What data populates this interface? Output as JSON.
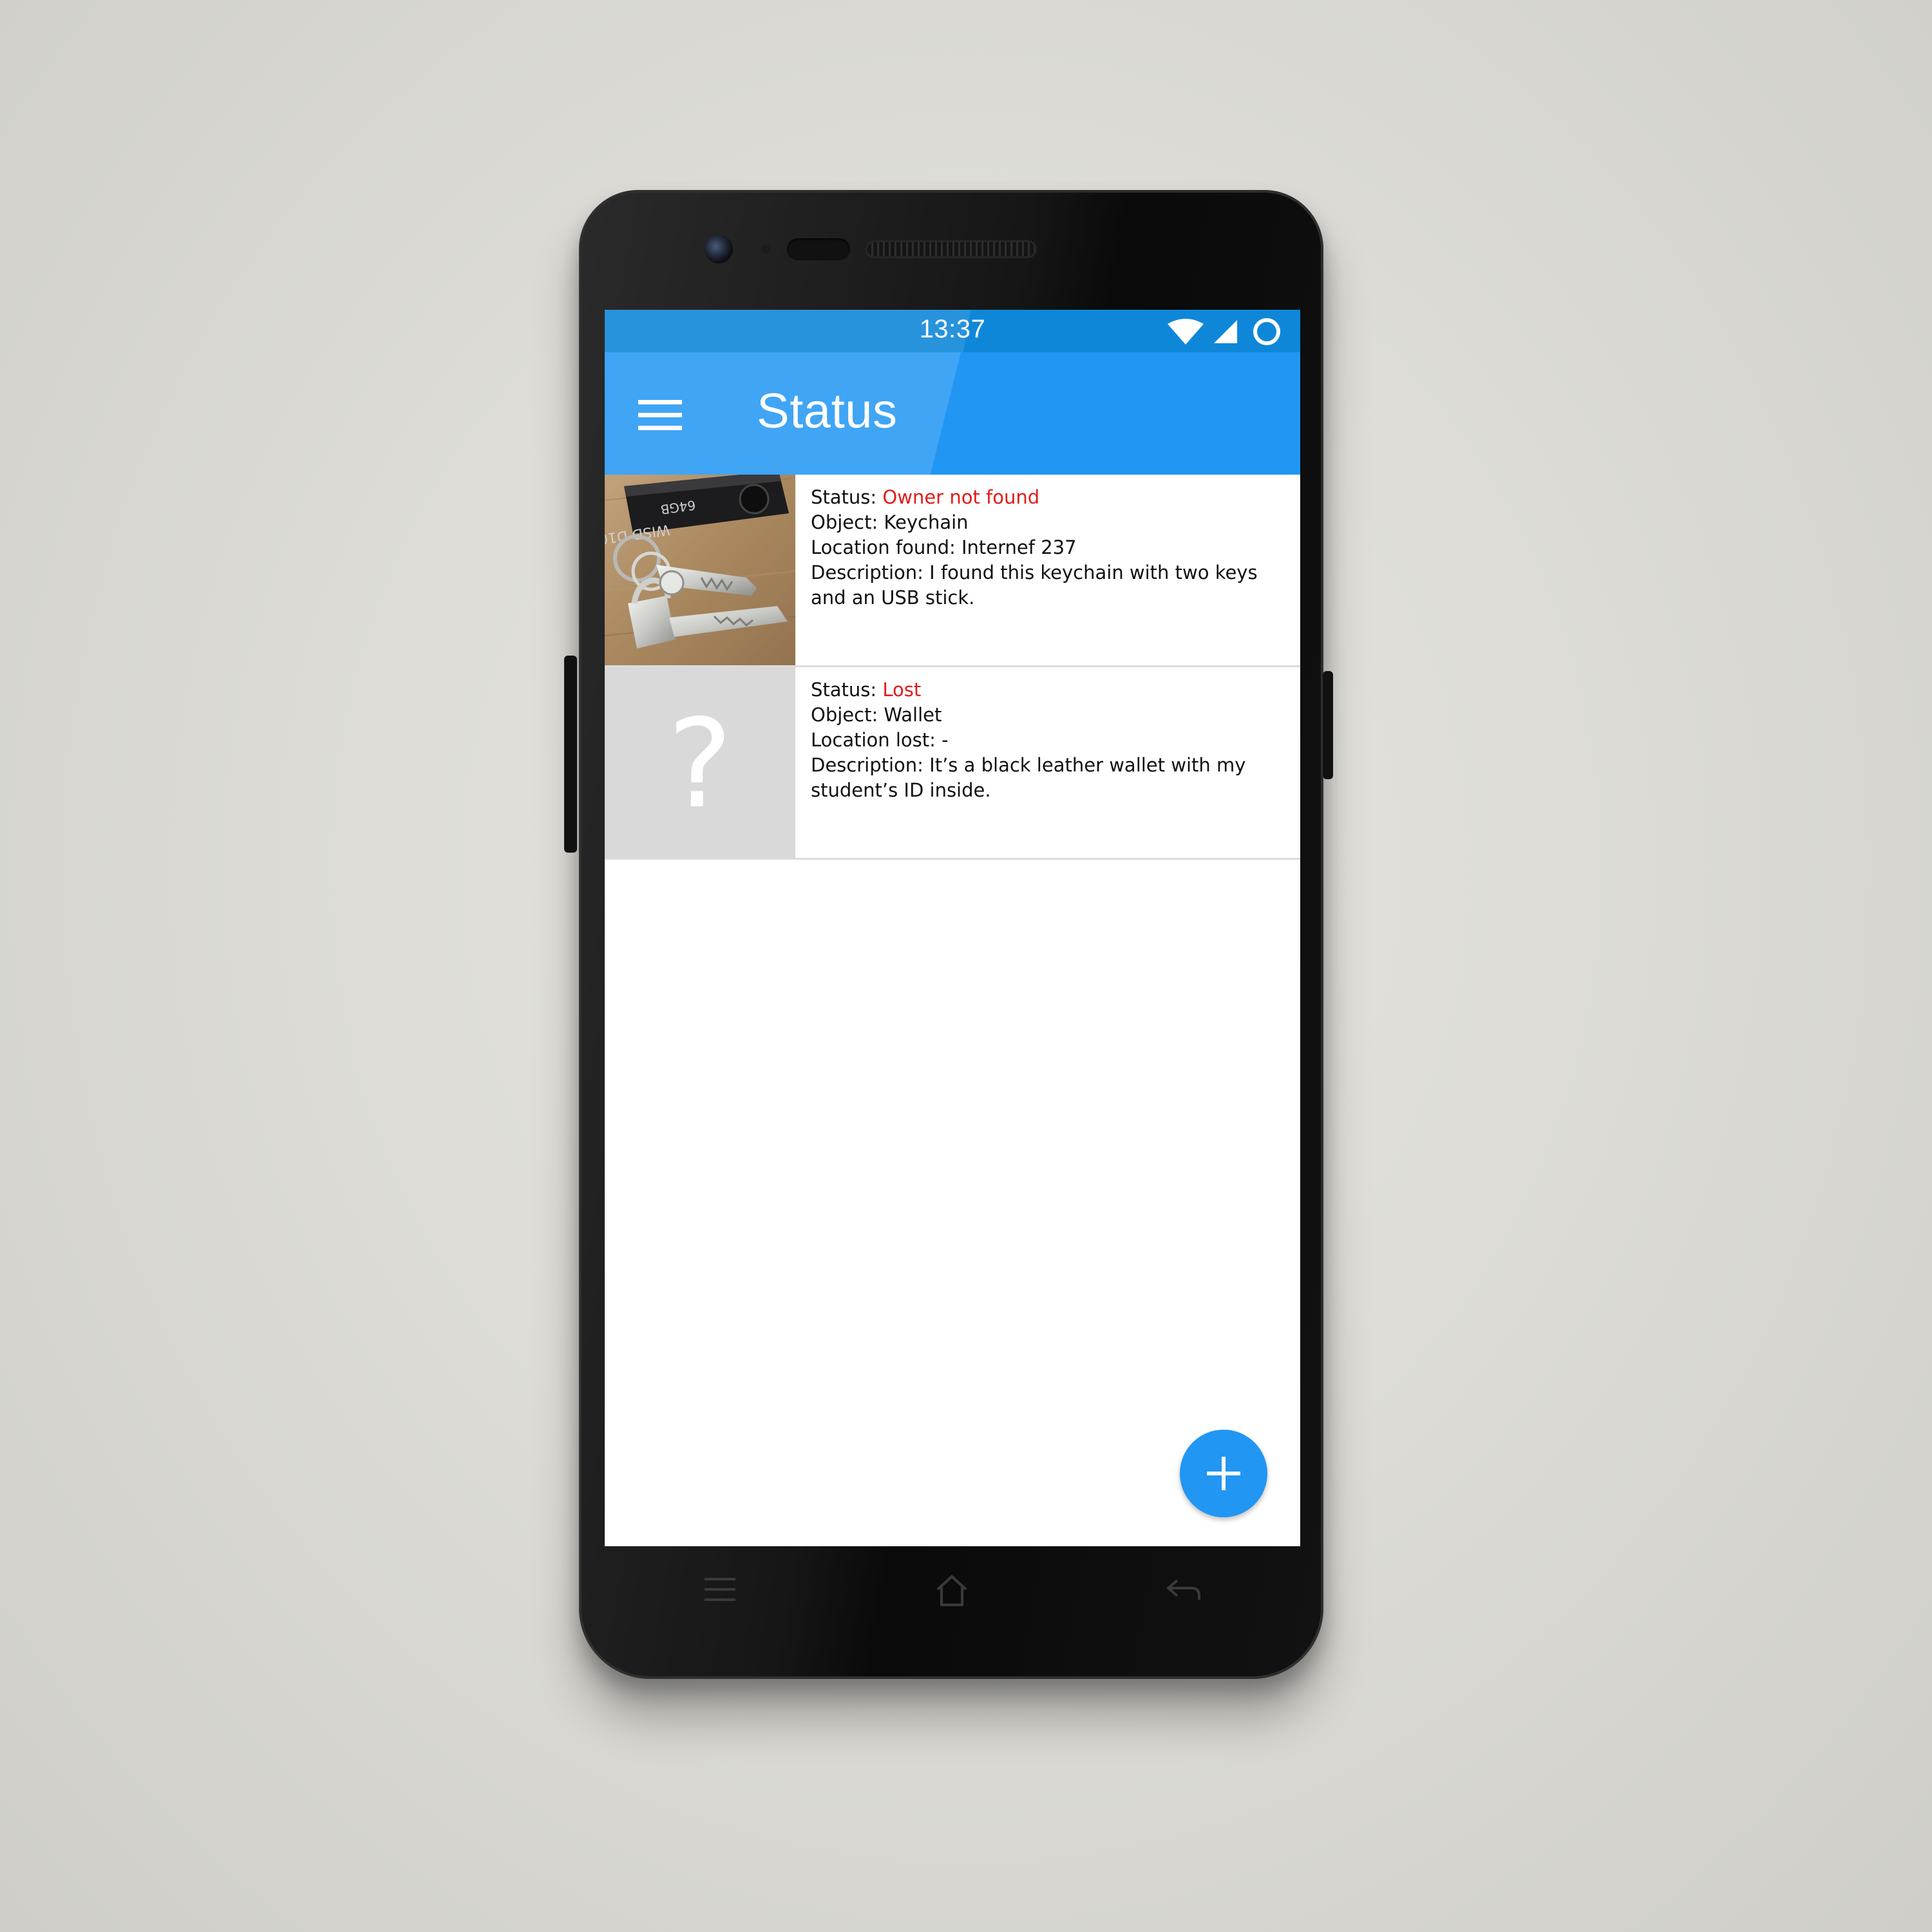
{
  "status_bar": {
    "time": "13:37",
    "icons": [
      "wifi-icon",
      "signal-icon",
      "circle-icon"
    ]
  },
  "app_bar": {
    "menu_icon": "hamburger-menu-icon",
    "title": "Status"
  },
  "items": [
    {
      "thumbnail": "keychain-photo",
      "status_label": "Status: ",
      "status_value": "Owner not found",
      "object": "Object: Keychain",
      "location": "Location found: Internef 237",
      "description_1": "Description: I found this keychain with two keys",
      "description_2": "and an USB stick."
    },
    {
      "thumbnail": "question-mark-icon",
      "thumbnail_glyph": "?",
      "status_label": "Status: ",
      "status_value": "Lost",
      "object": "Object: Wallet",
      "location": "Location lost: -",
      "description_1": "Description: It’s a black leather wallet with my",
      "description_2": "student’s ID inside."
    }
  ],
  "fab": {
    "icon": "plus-icon"
  },
  "nav_keys": [
    "menu-key-icon",
    "home-key-icon",
    "back-key-icon"
  ],
  "colors": {
    "primary": "#2196f3",
    "primary_dark": "#0f87d8",
    "status_value": "#e11b1b",
    "placeholder_bg": "#d9d9d9"
  }
}
